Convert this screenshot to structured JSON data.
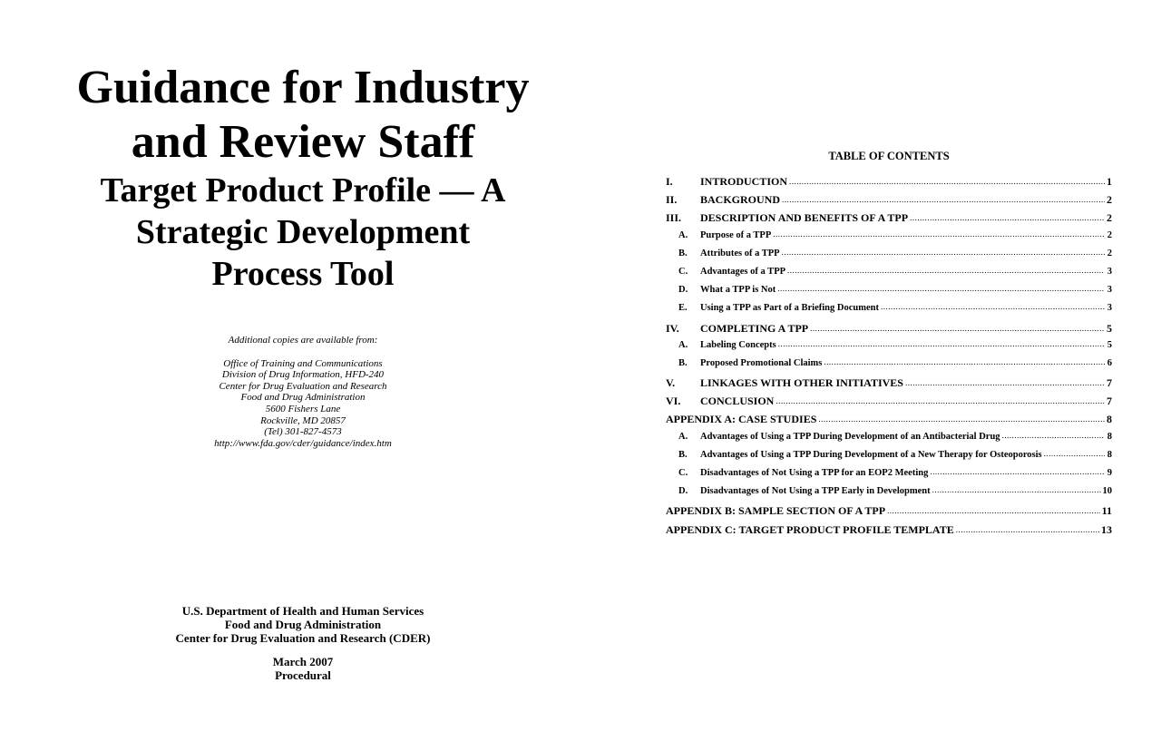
{
  "cover": {
    "title_line1": "Guidance for Industry",
    "title_line2": "and Review Staff",
    "subtitle_lines": [
      "Target Product Profile — A",
      "Strategic Development",
      "Process Tool"
    ],
    "availability_intro": "Additional copies are available from:",
    "address_lines": [
      "Office of Training and Communications",
      "Division of Drug Information, HFD-240",
      "Center for Drug Evaluation and Research",
      "Food and Drug Administration",
      "5600 Fishers Lane",
      "Rockville, MD  20857",
      "(Tel) 301-827-4573",
      "http://www.fda.gov/cder/guidance/index.htm"
    ],
    "publisher_lines": [
      "U.S. Department of Health and Human Services",
      "Food and Drug Administration",
      "Center for Drug Evaluation and Research (CDER)"
    ],
    "date": "March 2007",
    "category": "Procedural"
  },
  "toc": {
    "heading": "TABLE OF CONTENTS",
    "entries": [
      {
        "num": "I.",
        "title": "INTRODUCTION",
        "page": "1",
        "level": 1
      },
      {
        "num": "II.",
        "title": "BACKGROUND",
        "page": "2",
        "level": 1
      },
      {
        "num": "III.",
        "title": "DESCRIPTION AND BENEFITS OF A TPP",
        "page": "2",
        "level": 1
      },
      {
        "num": "A.",
        "title": "Purpose of a TPP",
        "page": "2",
        "level": 2
      },
      {
        "num": "B.",
        "title": "Attributes of a TPP",
        "page": "2",
        "level": 2
      },
      {
        "num": "C.",
        "title": "Advantages of a TPP",
        "page": "3",
        "level": 2
      },
      {
        "num": "D.",
        "title": "What a TPP is Not",
        "page": "3",
        "level": 2
      },
      {
        "num": "E.",
        "title": "Using a TPP as Part of a Briefing Document",
        "page": "3",
        "level": 2
      },
      {
        "num": "IV.",
        "title": "COMPLETING A TPP",
        "page": "5",
        "level": 1
      },
      {
        "num": "A.",
        "title": "Labeling Concepts",
        "page": "5",
        "level": 2
      },
      {
        "num": "B.",
        "title": "Proposed Promotional Claims",
        "page": "6",
        "level": 2
      },
      {
        "num": "V.",
        "title": "LINKAGES WITH OTHER INITIATIVES",
        "page": "7",
        "level": 1
      },
      {
        "num": "VI.",
        "title": "CONCLUSION",
        "page": "7",
        "level": 1
      },
      {
        "num": "",
        "title": "APPENDIX A: CASE STUDIES",
        "page": "8",
        "level": 0
      },
      {
        "num": "A.",
        "title": "Advantages of Using a TPP During Development of an Antibacterial Drug",
        "page": "8",
        "level": 2
      },
      {
        "num": "B.",
        "title": "Advantages of Using a TPP During Development of a New Therapy for Osteoporosis",
        "page": "8",
        "level": 2
      },
      {
        "num": "C.",
        "title": "Disadvantages of Not Using a TPP for an EOP2 Meeting",
        "page": "9",
        "level": 2
      },
      {
        "num": "D.",
        "title": "Disadvantages of Not Using a TPP Early in Development",
        "page": "10",
        "level": 2
      },
      {
        "num": "",
        "title": "APPENDIX B: SAMPLE SECTION OF A TPP",
        "page": "11",
        "level": 0
      },
      {
        "num": "",
        "title": "APPENDIX C: TARGET PRODUCT PROFILE TEMPLATE",
        "page": "13",
        "level": 0
      }
    ]
  }
}
